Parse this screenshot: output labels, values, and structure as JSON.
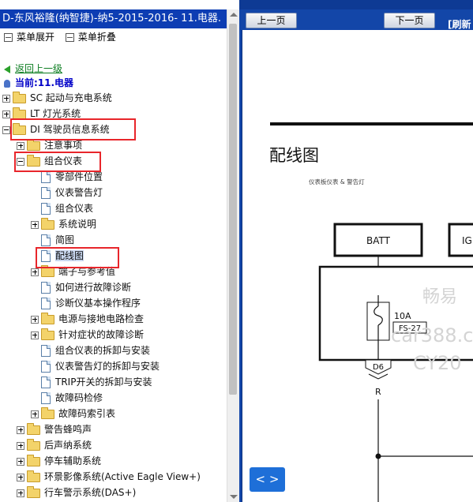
{
  "left_panel": {
    "title": "D-东风裕隆(纳智捷)-纳5-2015-2016- 11.电器.",
    "expand_label": "菜单展开",
    "collapse_label": "菜单折叠",
    "back_label": "返回上一级",
    "current_label": "当前:11.电器",
    "tree": [
      {
        "label": "SC 起动与充电系统",
        "type": "folder",
        "toggle": "plus"
      },
      {
        "label": "LT 灯光系统",
        "type": "folder",
        "toggle": "plus"
      },
      {
        "label": "DI 驾驶员信息系统",
        "type": "folder",
        "toggle": "minus"
      },
      {
        "label": "注意事项",
        "type": "folder",
        "toggle": "plus"
      },
      {
        "label": "组合仪表",
        "type": "folder",
        "toggle": "minus"
      },
      {
        "label": "零部件位置",
        "type": "doc",
        "toggle": ""
      },
      {
        "label": "仪表警告灯",
        "type": "doc",
        "toggle": ""
      },
      {
        "label": "组合仪表",
        "type": "doc",
        "toggle": ""
      },
      {
        "label": "系统说明",
        "type": "folder",
        "toggle": "plus"
      },
      {
        "label": "简图",
        "type": "doc",
        "toggle": ""
      },
      {
        "label": "配线图",
        "type": "doc",
        "toggle": ""
      },
      {
        "label": "端子与参考值",
        "type": "folder",
        "toggle": "plus"
      },
      {
        "label": "如何进行故障诊断",
        "type": "doc",
        "toggle": ""
      },
      {
        "label": "诊断仪基本操作程序",
        "type": "doc",
        "toggle": ""
      },
      {
        "label": "电源与接地电路检查",
        "type": "folder",
        "toggle": "plus"
      },
      {
        "label": "针对症状的故障诊断",
        "type": "folder",
        "toggle": "plus"
      },
      {
        "label": "组合仪表的拆卸与安装",
        "type": "doc",
        "toggle": ""
      },
      {
        "label": "仪表警告灯的拆卸与安装",
        "type": "doc",
        "toggle": ""
      },
      {
        "label": "TRIP开关的拆卸与安装",
        "type": "doc",
        "toggle": ""
      },
      {
        "label": "故障码检修",
        "type": "doc",
        "toggle": ""
      },
      {
        "label": "故障码索引表",
        "type": "folder",
        "toggle": "plus"
      },
      {
        "label": "警告蜂鸣声",
        "type": "folder",
        "toggle": "plus"
      },
      {
        "label": "后声纳系统",
        "type": "folder",
        "toggle": "plus"
      },
      {
        "label": "停车辅助系统",
        "type": "folder",
        "toggle": "plus"
      },
      {
        "label": "环景影像系统(Active Eagle View+)",
        "type": "folder",
        "toggle": "plus"
      },
      {
        "label": "行车警示系统(DAS+)",
        "type": "folder",
        "toggle": "plus"
      }
    ]
  },
  "viewer": {
    "prev_label": "上一页",
    "next_label": "下一页",
    "refresh_label": "[刷新",
    "page_title": "配线图",
    "page_subtitle": "仪表板仪表 & 警告灯",
    "batt_label": "BATT",
    "ig_label": "IG",
    "fuse_rating": "10A",
    "fuse_id": "FS-27",
    "connector_id": "D6",
    "wire_color": "R",
    "watermark_1": "畅易",
    "watermark_2": "car388.c",
    "watermark_3": "CY20",
    "nav_pair_label": "< >"
  },
  "colors": {
    "title_bar": "#0d3db3",
    "highlight_box": "#e8262b",
    "viewer_bg": "#1346a8",
    "back_link": "#0a7c1f",
    "current_label": "#0000c8"
  }
}
